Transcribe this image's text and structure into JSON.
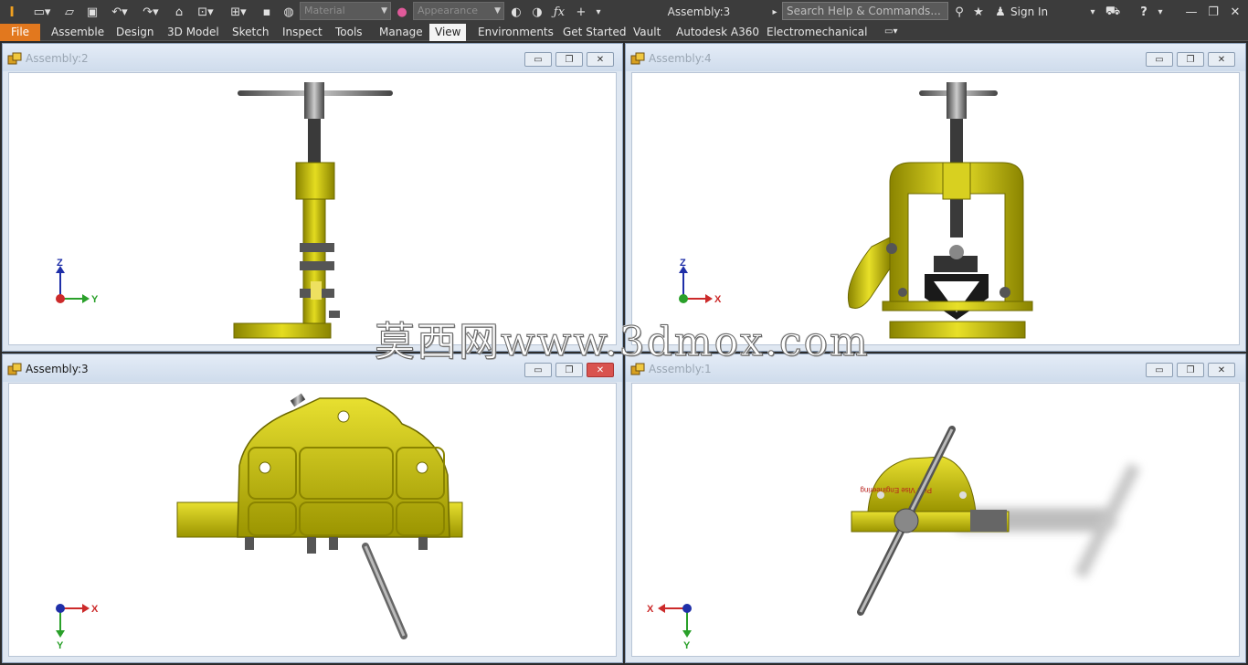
{
  "app": {
    "title": "Assembly:3",
    "material_placeholder": "Material",
    "appearance_placeholder": "Appearance",
    "search_placeholder": "Search Help & Commands...",
    "sign_in": "Sign In",
    "help": "?"
  },
  "ribbon": {
    "tabs": [
      {
        "label": "File"
      },
      {
        "label": "Assemble"
      },
      {
        "label": "Design"
      },
      {
        "label": "3D Model"
      },
      {
        "label": "Sketch"
      },
      {
        "label": "Inspect"
      },
      {
        "label": "Tools"
      },
      {
        "label": "Manage"
      },
      {
        "label": "View"
      },
      {
        "label": "Environments"
      },
      {
        "label": "Get Started"
      },
      {
        "label": "Vault"
      },
      {
        "label": "Autodesk A360"
      },
      {
        "label": "Electromechanical"
      }
    ],
    "active_tab": "View"
  },
  "panes": [
    {
      "title": "Assembly:2",
      "axes": [
        "Z",
        "Y"
      ]
    },
    {
      "title": "Assembly:4",
      "axes": [
        "Z",
        "X"
      ]
    },
    {
      "title": "Assembly:3",
      "axes": [
        "X",
        "Y"
      ]
    },
    {
      "title": "Assembly:1",
      "axes": [
        "X",
        "Y"
      ]
    }
  ],
  "part_label": "Pipe Vise Engineering",
  "watermark": "莫西网www.3dmox.com",
  "colors": {
    "accent_file": "#e2781e",
    "model_yellow": "#c8c000",
    "axis_x": "#cc2a2a",
    "axis_y": "#2aa02a",
    "axis_z": "#1f2fa8"
  }
}
